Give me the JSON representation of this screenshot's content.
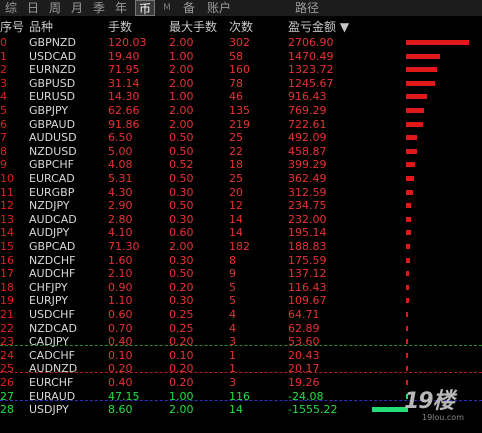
{
  "tabs": [
    {
      "label": "综"
    },
    {
      "label": "日"
    },
    {
      "label": "周"
    },
    {
      "label": "月"
    },
    {
      "label": "季"
    },
    {
      "label": "年"
    },
    {
      "label": "币"
    },
    {
      "label": "M"
    },
    {
      "label": "备"
    },
    {
      "label": "账户"
    },
    {
      "label": "路径"
    }
  ],
  "header": {
    "idx": "序号",
    "symbol": "品种",
    "lots": "手数",
    "max_lots": "最大手数",
    "count": "次数",
    "pnl": "盈亏金额 ▼"
  },
  "rows": [
    {
      "idx": "0",
      "symbol": "GBPNZD",
      "lots": "120.03",
      "max": "2.00",
      "count": "302",
      "pnl": "2706.90",
      "bar": 2706.9
    },
    {
      "idx": "1",
      "symbol": "USDCAD",
      "lots": "19.40",
      "max": "1.00",
      "count": "58",
      "pnl": "1470.49",
      "bar": 1470.49
    },
    {
      "idx": "2",
      "symbol": "EURNZD",
      "lots": "71.95",
      "max": "2.00",
      "count": "160",
      "pnl": "1323.72",
      "bar": 1323.72
    },
    {
      "idx": "3",
      "symbol": "GBPUSD",
      "lots": "31.14",
      "max": "2.00",
      "count": "78",
      "pnl": "1245.67",
      "bar": 1245.67
    },
    {
      "idx": "4",
      "symbol": "EURUSD",
      "lots": "14.30",
      "max": "1.00",
      "count": "46",
      "pnl": "916.43",
      "bar": 916.43
    },
    {
      "idx": "5",
      "symbol": "GBPJPY",
      "lots": "62.66",
      "max": "2.00",
      "count": "135",
      "pnl": "769.29",
      "bar": 769.29
    },
    {
      "idx": "6",
      "symbol": "GBPAUD",
      "lots": "91.86",
      "max": "2.00",
      "count": "219",
      "pnl": "722.61",
      "bar": 722.61
    },
    {
      "idx": "7",
      "symbol": "AUDUSD",
      "lots": "6.50",
      "max": "0.50",
      "count": "25",
      "pnl": "492.09",
      "bar": 492.09
    },
    {
      "idx": "8",
      "symbol": "NZDUSD",
      "lots": "5.00",
      "max": "0.50",
      "count": "22",
      "pnl": "458.87",
      "bar": 458.87
    },
    {
      "idx": "9",
      "symbol": "GBPCHF",
      "lots": "4.08",
      "max": "0.52",
      "count": "18",
      "pnl": "399.29",
      "bar": 399.29
    },
    {
      "idx": "10",
      "symbol": "EURCAD",
      "lots": "5.31",
      "max": "0.50",
      "count": "25",
      "pnl": "362.49",
      "bar": 362.49
    },
    {
      "idx": "11",
      "symbol": "EURGBP",
      "lots": "4.30",
      "max": "0.30",
      "count": "20",
      "pnl": "312.59",
      "bar": 312.59
    },
    {
      "idx": "12",
      "symbol": "NZDJPY",
      "lots": "2.90",
      "max": "0.50",
      "count": "12",
      "pnl": "234.75",
      "bar": 234.75
    },
    {
      "idx": "13",
      "symbol": "AUDCAD",
      "lots": "2.80",
      "max": "0.30",
      "count": "14",
      "pnl": "232.00",
      "bar": 232.0
    },
    {
      "idx": "14",
      "symbol": "AUDJPY",
      "lots": "4.10",
      "max": "0.60",
      "count": "14",
      "pnl": "195.14",
      "bar": 195.14
    },
    {
      "idx": "15",
      "symbol": "GBPCAD",
      "lots": "71.30",
      "max": "2.00",
      "count": "182",
      "pnl": "188.83",
      "bar": 188.83
    },
    {
      "idx": "16",
      "symbol": "NZDCHF",
      "lots": "1.60",
      "max": "0.30",
      "count": "8",
      "pnl": "175.59",
      "bar": 175.59
    },
    {
      "idx": "17",
      "symbol": "AUDCHF",
      "lots": "2.10",
      "max": "0.50",
      "count": "9",
      "pnl": "137.12",
      "bar": 137.12
    },
    {
      "idx": "18",
      "symbol": "CHFJPY",
      "lots": "0.90",
      "max": "0.20",
      "count": "5",
      "pnl": "116.43",
      "bar": 116.43
    },
    {
      "idx": "19",
      "symbol": "EURJPY",
      "lots": "1.10",
      "max": "0.30",
      "count": "5",
      "pnl": "109.67",
      "bar": 109.67
    },
    {
      "idx": "21",
      "symbol": "USDCHF",
      "lots": "0.60",
      "max": "0.25",
      "count": "4",
      "pnl": "64.71",
      "bar": 64.71
    },
    {
      "idx": "22",
      "symbol": "NZDCAD",
      "lots": "0.70",
      "max": "0.25",
      "count": "4",
      "pnl": "62.89",
      "bar": 62.89
    },
    {
      "idx": "23",
      "symbol": "CADJPY",
      "lots": "0.40",
      "max": "0.20",
      "count": "3",
      "pnl": "53.60",
      "bar": 53.6
    },
    {
      "idx": "24",
      "symbol": "CADCHF",
      "lots": "0.10",
      "max": "0.10",
      "count": "1",
      "pnl": "20.43",
      "bar": 20.43
    },
    {
      "idx": "25",
      "symbol": "AUDNZD",
      "lots": "0.20",
      "max": "0.20",
      "count": "1",
      "pnl": "20.17",
      "bar": 20.17
    },
    {
      "idx": "26",
      "symbol": "EURCHF",
      "lots": "0.40",
      "max": "0.20",
      "count": "3",
      "pnl": "19.26",
      "bar": 19.26
    },
    {
      "idx": "27",
      "symbol": "EURAUD",
      "lots": "47.15",
      "max": "1.00",
      "count": "116",
      "pnl": "-24.08",
      "bar": -24.08,
      "negative": true
    },
    {
      "idx": "28",
      "symbol": "USDJPY",
      "lots": "8.60",
      "max": "2.00",
      "count": "14",
      "pnl": "-1555.22",
      "bar": -1555.22,
      "negative": true
    }
  ],
  "bar_scale_max": 2706.9,
  "colors": {
    "positive": "#e01818",
    "negative": "#22dd77",
    "divider_green": "#2e8b2e",
    "divider_red": "#b02020",
    "divider_blue": "#3030c0"
  },
  "watermark": {
    "main": "19楼",
    "sub": "19lou.com"
  }
}
